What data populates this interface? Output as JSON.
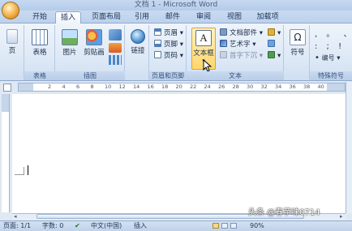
{
  "window": {
    "title": "文档 1 - Microsoft Word"
  },
  "tabs": [
    "开始",
    "插入",
    "页面布局",
    "引用",
    "邮件",
    "审阅",
    "视图",
    "加载项"
  ],
  "active_tab": "插入",
  "ribbon": {
    "pages_button": "页",
    "table_button": "表格",
    "picture_button": "图片",
    "clipart_button": "剪贴画",
    "link_button": "链接",
    "header_button": "页眉",
    "footer_button": "页脚",
    "pagenum_button": "页码",
    "textbox_button": "文本框",
    "quickparts_button": "文档部件",
    "wordart_button": "艺术字",
    "dropcap_button": "首字下沉",
    "symbol_button": "符号",
    "omega": "Ω",
    "numbering": "编号",
    "groups": {
      "tables": "表格",
      "illustrations": "插图",
      "header_footer": "页眉和页脚",
      "text": "文本",
      "special": "特殊符号"
    }
  },
  "ruler_numbers": [
    "2",
    "4",
    "6",
    "8",
    "10",
    "12",
    "14",
    "16",
    "18",
    "20",
    "22",
    "24",
    "26",
    "28",
    "30",
    "32",
    "34",
    "36",
    "38",
    "40"
  ],
  "status": {
    "page": "页面: 1/1",
    "words": "字数: 0",
    "language": "中文(中国)",
    "mode": "插入",
    "zoom": "90%"
  },
  "watermark": "头条 @春芋味0714",
  "colors": {
    "ribbon_bg": "#dbe7f5",
    "highlight": "#ffd66b",
    "status_bg": "#c9d9ee"
  }
}
